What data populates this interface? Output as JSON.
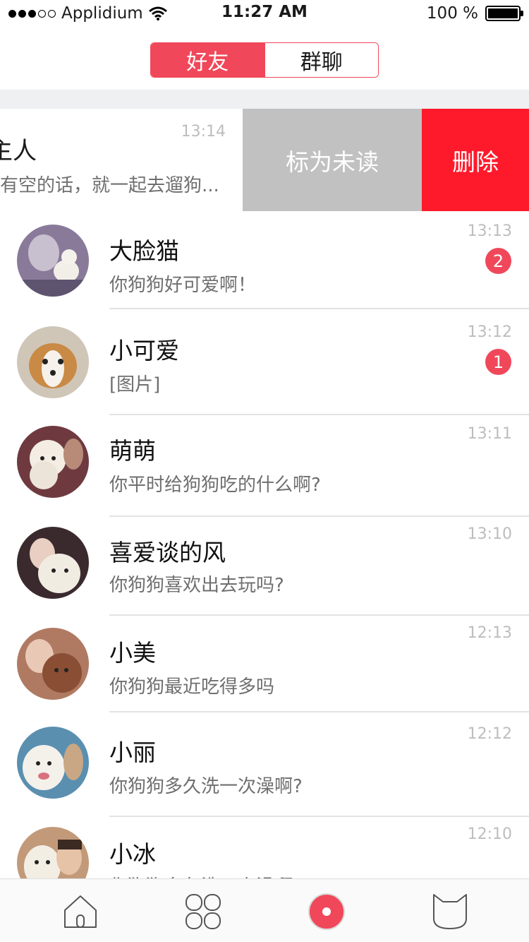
{
  "status_bar": {
    "carrier": "Applidium",
    "time": "11:27 AM",
    "battery": "100 %"
  },
  "segment": {
    "friends": "好友",
    "groups": "群聊",
    "active": "friends"
  },
  "swiped_row": {
    "name": "主人",
    "preview": "有空的话，就一起去遛狗...",
    "time": "13:14",
    "mark_unread": "标为未读",
    "delete": "删除"
  },
  "chats": [
    {
      "name": "大脸猫",
      "preview": "你狗狗好可爱啊！",
      "time": "13:13",
      "badge": "2"
    },
    {
      "name": "小可爱",
      "preview": "[图片]",
      "time": "13:12",
      "badge": "1"
    },
    {
      "name": "萌萌",
      "preview": "你平时给狗狗吃的什么啊?",
      "time": "13:11",
      "badge": null
    },
    {
      "name": "喜爱谈的风",
      "preview": "你狗狗喜欢出去玩吗?",
      "time": "13:10",
      "badge": null
    },
    {
      "name": "小美",
      "preview": "你狗狗最近吃得多吗",
      "time": "12:13",
      "badge": null
    },
    {
      "name": "小丽",
      "preview": "你狗狗多久洗一次澡啊?",
      "time": "12:12",
      "badge": null
    },
    {
      "name": "小冰",
      "preview": "你狗狗多久洗一次澡啊?",
      "time": "12:10",
      "badge": null
    }
  ],
  "tabs": [
    {
      "icon": "home-icon"
    },
    {
      "icon": "grid-icon"
    },
    {
      "icon": "record-icon"
    },
    {
      "icon": "cat-icon"
    }
  ],
  "colors": {
    "accent": "#f0485a",
    "delete": "#ff1a2b",
    "mark_unread": "#c1c1c1"
  }
}
